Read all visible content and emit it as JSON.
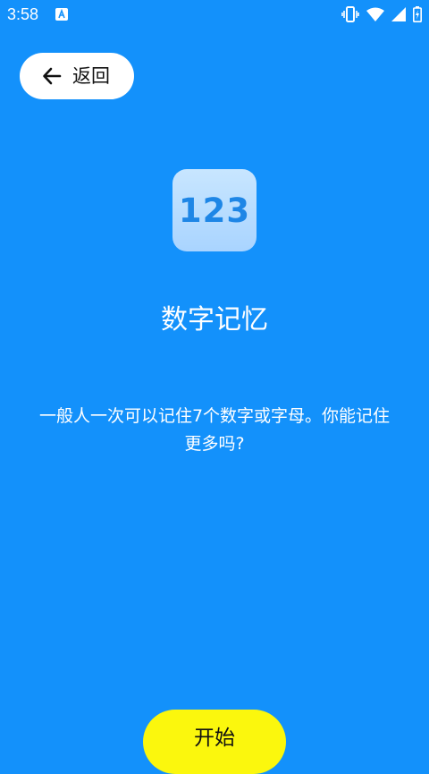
{
  "status_bar": {
    "time": "3:58",
    "icons": [
      "app-notification-icon",
      "vibrate-icon",
      "wifi-icon",
      "signal-icon",
      "battery-charging-icon"
    ]
  },
  "back_button": {
    "icon": "arrow-left-icon",
    "label": "返回"
  },
  "app_icon": {
    "text": "123"
  },
  "title": "数字记忆",
  "description": "一般人一次可以记住7个数字或字母。你能记住更多吗?",
  "start_button": {
    "label": "开始"
  },
  "colors": {
    "background": "#1391fb",
    "start_button": "#fbf70d",
    "icon_text": "#1e86e6"
  }
}
